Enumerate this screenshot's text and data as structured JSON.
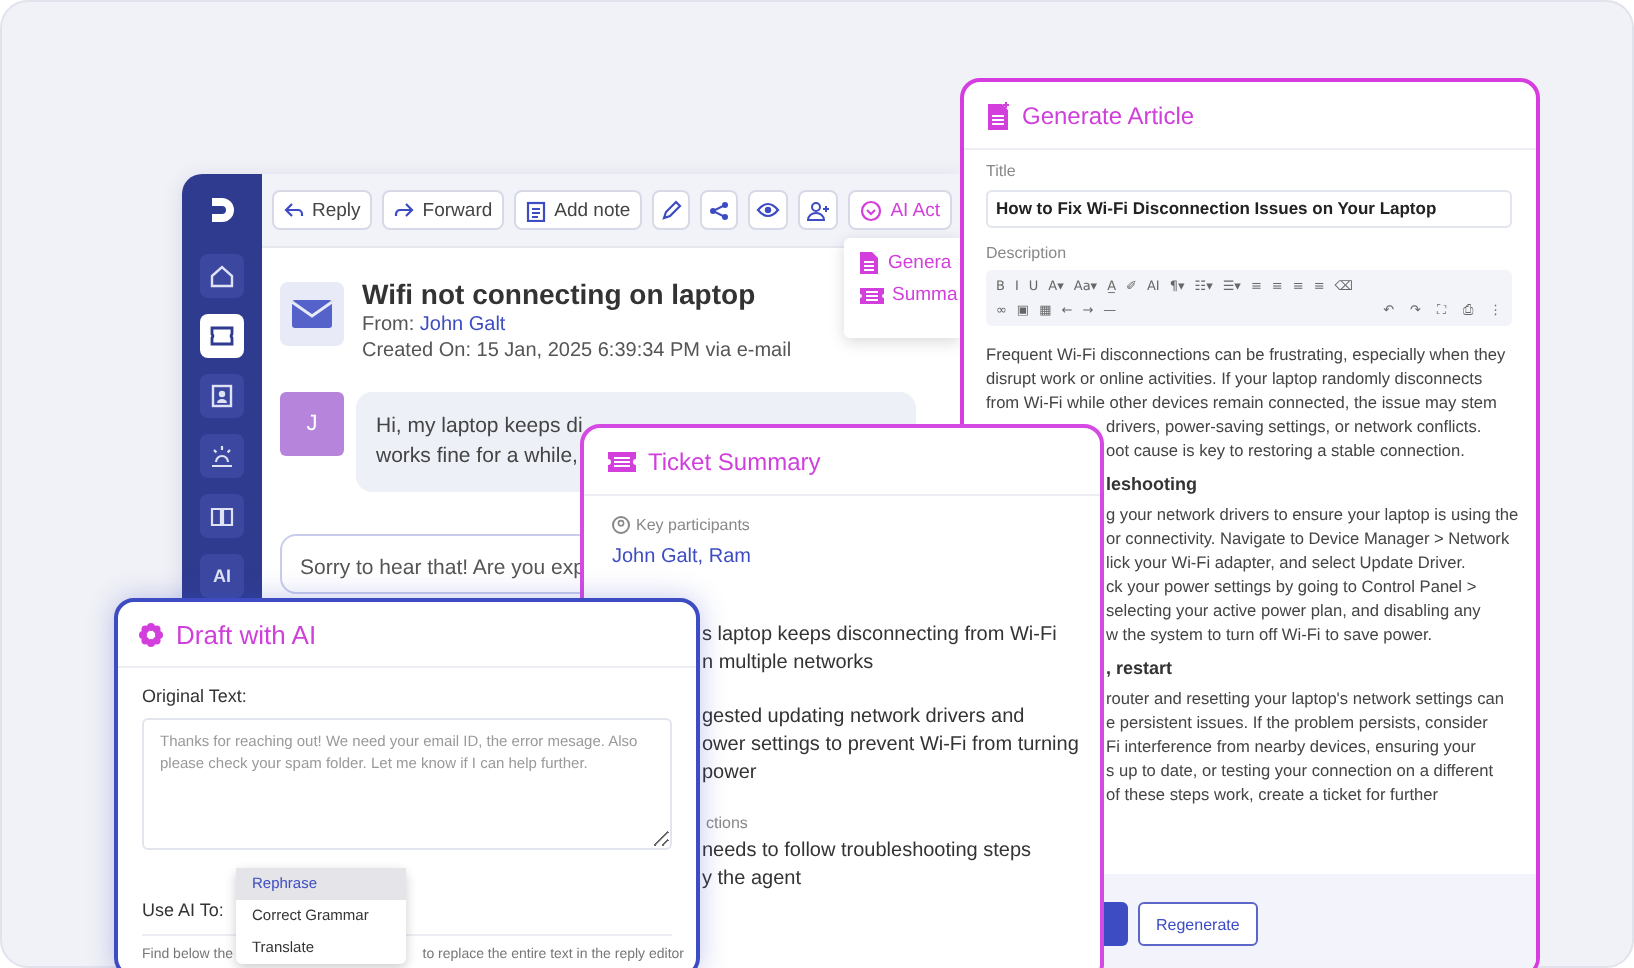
{
  "email_window": {
    "sidebar": [
      {
        "kind": "home",
        "selected": false
      },
      {
        "kind": "ticket",
        "selected": true
      },
      {
        "kind": "contact",
        "selected": false
      },
      {
        "kind": "alert",
        "selected": false
      },
      {
        "kind": "book",
        "selected": false
      },
      {
        "kind": "text",
        "label": "AI",
        "selected": false
      }
    ],
    "toolbar": [
      {
        "kind": "reply",
        "label": "Reply"
      },
      {
        "kind": "forward",
        "label": "Forward"
      },
      {
        "kind": "note",
        "label": "Add note"
      },
      {
        "kind": "pencil"
      },
      {
        "kind": "share"
      },
      {
        "kind": "eye"
      },
      {
        "kind": "user-add"
      },
      {
        "kind": "ai",
        "label": "AI Act"
      }
    ],
    "ai_menu": [
      {
        "kind": "article",
        "label": "Genera"
      },
      {
        "kind": "summary",
        "label": "Summa"
      }
    ],
    "ticket": {
      "title": "Wifi not connecting on laptop",
      "from_label": "From:",
      "from": "John Galt",
      "created": "Created On: 15 Jan, 2025 6:39:34 PM via e-mail"
    },
    "message": {
      "avatar": "J",
      "lines": [
        "Hi, my laptop keeps di",
        "works fine for a while,"
      ]
    },
    "reply_preview": "Sorry to hear that! Are you exp"
  },
  "generate_article": {
    "title": "Generate Article",
    "title_label": "Title",
    "title_value": "How to Fix Wi-Fi Disconnection Issues on Your Laptop",
    "description_label": "Description",
    "toolbar_rows": [
      [
        "B",
        "I",
        "U",
        "A▾",
        "Aa▾",
        "A̲",
        "✐",
        "AI",
        "¶▾",
        "☷▾",
        "☰▾",
        "≡",
        "≡",
        "≡",
        "≡",
        "⌫"
      ],
      [
        "∞",
        "▣",
        "▦",
        "←",
        "→",
        "—"
      ]
    ],
    "toolbar_right": [
      "↶",
      "↷",
      "⛶",
      "⎙",
      "⋮"
    ],
    "lines": [
      "Frequent Wi-Fi disconnections can be frustrating, especially when they",
      "disrupt work or online activities. If your laptop randomly disconnects",
      "from Wi-Fi while other devices remain connected, the issue may stem"
    ],
    "covered_lines": [
      {
        "kind": "text",
        "text": "drivers, power-saving settings, or network conflicts."
      },
      {
        "kind": "text",
        "text": "oot cause is key to restoring a stable connection."
      },
      {
        "kind": "heading",
        "text": "leshooting"
      },
      {
        "kind": "text",
        "text": "g your network drivers to ensure your laptop is using the"
      },
      {
        "kind": "text",
        "text": "or connectivity. Navigate to Device Manager > Network"
      },
      {
        "kind": "text",
        "text": "lick your Wi-Fi adapter, and select Update Driver."
      },
      {
        "kind": "text",
        "text": "ck your power settings by going to Control Panel >"
      },
      {
        "kind": "text",
        "text": "selecting your active power plan, and disabling any"
      },
      {
        "kind": "text",
        "text": "w the system to turn off Wi-Fi to save power."
      },
      {
        "kind": "heading",
        "text": ", restart"
      },
      {
        "kind": "text",
        "text": "router and resetting your laptop's network settings can"
      },
      {
        "kind": "text",
        "text": "e persistent issues. If the problem persists, consider"
      },
      {
        "kind": "text",
        "text": "Fi interference from nearby devices, ensuring your"
      },
      {
        "kind": "text",
        "text": "s up to date, or testing your connection on a different"
      },
      {
        "kind": "text",
        "text": "of these steps work, create a ticket for further"
      }
    ],
    "secondary_button": "Regenerate"
  },
  "ticket_summary": {
    "title": "Ticket Summary",
    "participants_label": "Key participants",
    "participants": "John Galt, Ram",
    "sections": [
      {
        "lines": [
          "s laptop keeps disconnecting from Wi-Fi",
          "n multiple networks"
        ]
      },
      {
        "lines": [
          "gested updating network drivers and",
          "ower settings to prevent Wi-Fi from turning",
          "power"
        ]
      },
      {
        "label": "ctions",
        "lines": [
          "needs to follow troubleshooting steps",
          "y the agent"
        ]
      }
    ]
  },
  "draft_with_ai": {
    "title": "Draft with AI",
    "original_label": "Original Text:",
    "placeholder": "Thanks for reaching out! We need your email ID, the error mesage. Also please check your spam folder. Let me know if I can help further.",
    "use_label": "Use AI To:",
    "options": [
      {
        "label": "Rephrase",
        "selected": true
      },
      {
        "label": "Correct Grammar",
        "selected": false
      },
      {
        "label": "Translate",
        "selected": false
      }
    ],
    "hint_start": "Find below the",
    "hint_end": "to replace the entire text in the reply editor"
  }
}
